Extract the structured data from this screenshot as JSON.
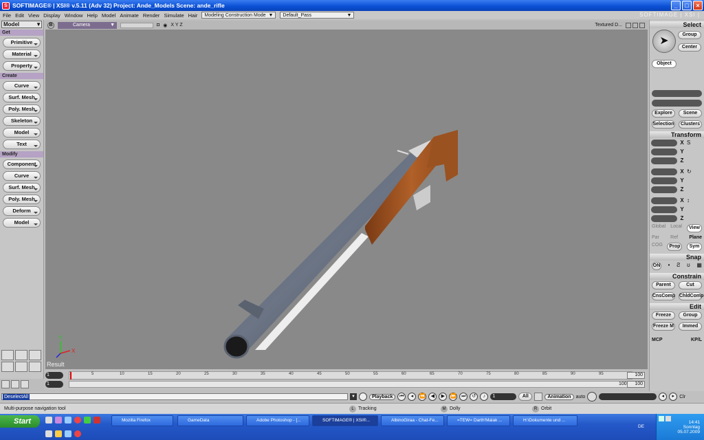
{
  "window": {
    "title": "SOFTIMAGE® | XSI® v.5.11 (Adv 32) Project: Ande_Models    Scene: ande_rifle",
    "brand": "SOFTIMAGE | XSI |"
  },
  "menu": [
    "File",
    "Edit",
    "View",
    "Display",
    "Window",
    "Help",
    "Model",
    "Animate",
    "Render",
    "Simulate",
    "Hair"
  ],
  "menu_combo1": "Modeling Construction Mode",
  "menu_combo2": "Default_Pass",
  "left": {
    "module": "Model",
    "get_header": "Get",
    "get_items": [
      "Primitive",
      "Material",
      "Property"
    ],
    "create_header": "Create",
    "create_items": [
      "Curve",
      "Surf. Mesh",
      "Poly. Mesh",
      "Skeleton",
      "Model",
      "Text"
    ],
    "modify_header": "Modify",
    "modify_items": [
      "Component",
      "Curve",
      "Surf. Mesh",
      "Poly. Mesh",
      "Deform",
      "Model"
    ]
  },
  "viewport": {
    "view_letter": "B",
    "camera": "Camera",
    "axes": "X  Y  Z",
    "shading": "Textured D...",
    "result": "Result",
    "axis_x": "X",
    "axis_y": "Y"
  },
  "right": {
    "select_header": "Select",
    "group": "Group",
    "center": "Center",
    "object": "Object",
    "explore": "Explore",
    "scene": "Scene",
    "selection": "Selection",
    "clusters": "Clusters",
    "transform_header": "Transform",
    "axes": [
      "X",
      "Y",
      "Z"
    ],
    "global": "Global",
    "local": "Local",
    "view": "View",
    "par": "Par",
    "ref": "Ref",
    "plane": "Plane",
    "cog": "COG",
    "prop": "Prop",
    "sym": "Sym",
    "snap_header": "Snap",
    "on": "ON",
    "constrain_header": "Constrain",
    "parent": "Parent",
    "cut": "Cut",
    "cnscomp": "CnsComp",
    "chldcomp": "ChldComp",
    "edit_header": "Edit",
    "freeze": "Freeze",
    "group2": "Group",
    "freezem": "Freeze M",
    "immed": "Immed",
    "mcp": "MCP",
    "kpl": "KP/L"
  },
  "timeline": {
    "ticks": [
      "1",
      "5",
      "10",
      "15",
      "20",
      "25",
      "30",
      "35",
      "40",
      "45",
      "50",
      "55",
      "60",
      "65",
      "70",
      "75",
      "80",
      "85",
      "90",
      "95"
    ],
    "start1": "1",
    "end1": "100",
    "start2": "1",
    "end2": "100",
    "end3": "100"
  },
  "playback": {
    "command": "DeselectAll",
    "playback_label": "Playback",
    "all": "All",
    "animation": "Animation",
    "auto": "auto",
    "clr": "Clr",
    "frame": "1"
  },
  "status": {
    "message": "Multi-purpose navigation tool",
    "l": "L",
    "tracking": "Tracking",
    "m": "M",
    "dolly": "Dolly",
    "r": "R",
    "orbit": "Orbit"
  },
  "taskbar": {
    "start": "Start",
    "items": [
      "Mozilla Firefox",
      "GameData",
      "Adobe Photoshop - [...",
      "SOFTIMAGE® | XSI®...",
      "AlbinoGiraa - Chat-Fe...",
      "=TEW= Darth'Malak ...",
      "H:\\Dokumente und ..."
    ],
    "lang": "DE",
    "time": "14:41",
    "day": "Sonntag",
    "date": "05.07.2009"
  }
}
